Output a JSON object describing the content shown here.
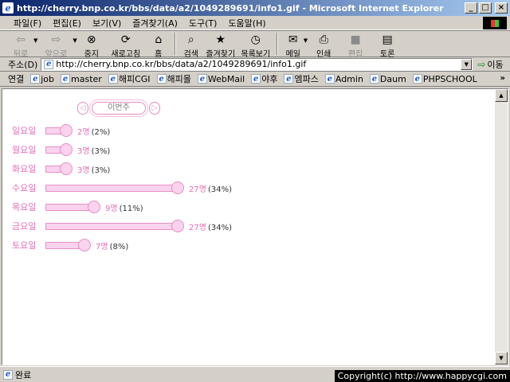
{
  "window": {
    "title": "http://cherry.bnp.co.kr/bbs/data/a2/1049289691/info1.gif - Microsoft Internet Explorer",
    "controls": [
      "_",
      "□",
      "×"
    ]
  },
  "menu": [
    "파일(F)",
    "편집(E)",
    "보기(V)",
    "즐겨찾기(A)",
    "도구(T)",
    "도움말(H)"
  ],
  "toolbar": {
    "back": "뒤로",
    "forward": "앞으로",
    "stop": "중지",
    "refresh": "새로고침",
    "home": "홈",
    "search": "검색",
    "favorites": "즐겨찾기",
    "history": "목록보기",
    "mail": "메일",
    "print": "인쇄",
    "edit": "편집",
    "discuss": "토론"
  },
  "address": {
    "label": "주소(D)",
    "url": "http://cherry.bnp.co.kr/bbs/data/a2/1049289691/info1.gif",
    "go": "이동"
  },
  "links": {
    "label": "연결",
    "items": [
      "job",
      "master",
      "해피CGI",
      "해피몰",
      "WebMail",
      "야후",
      "엠파스",
      "Admin",
      "Daum",
      "PHPSCHOOL"
    ],
    "more": "»"
  },
  "content": {
    "week_label": "이번주",
    "days": [
      {
        "day": "일요일",
        "count": "2명",
        "percent": "(2%)",
        "value": 2
      },
      {
        "day": "월요일",
        "count": "3명",
        "percent": "(3%)",
        "value": 3
      },
      {
        "day": "화요일",
        "count": "3명",
        "percent": "(3%)",
        "value": 3
      },
      {
        "day": "수요일",
        "count": "27명",
        "percent": "(34%)",
        "value": 27
      },
      {
        "day": "목요일",
        "count": "9명",
        "percent": "(11%)",
        "value": 9
      },
      {
        "day": "금요일",
        "count": "27명",
        "percent": "(34%)",
        "value": 27
      },
      {
        "day": "토요일",
        "count": "7명",
        "percent": "(8%)",
        "value": 7
      }
    ],
    "max_value": 27
  },
  "status": {
    "text": "완료",
    "copyright": "Copyright(c) http://www.happycgi.com"
  },
  "colors": {
    "accent_pink": "#e06fb6",
    "bar_fill": "#fbd3ef",
    "title_gradient_start": "#0a246a",
    "title_gradient_end": "#a6caf0"
  }
}
